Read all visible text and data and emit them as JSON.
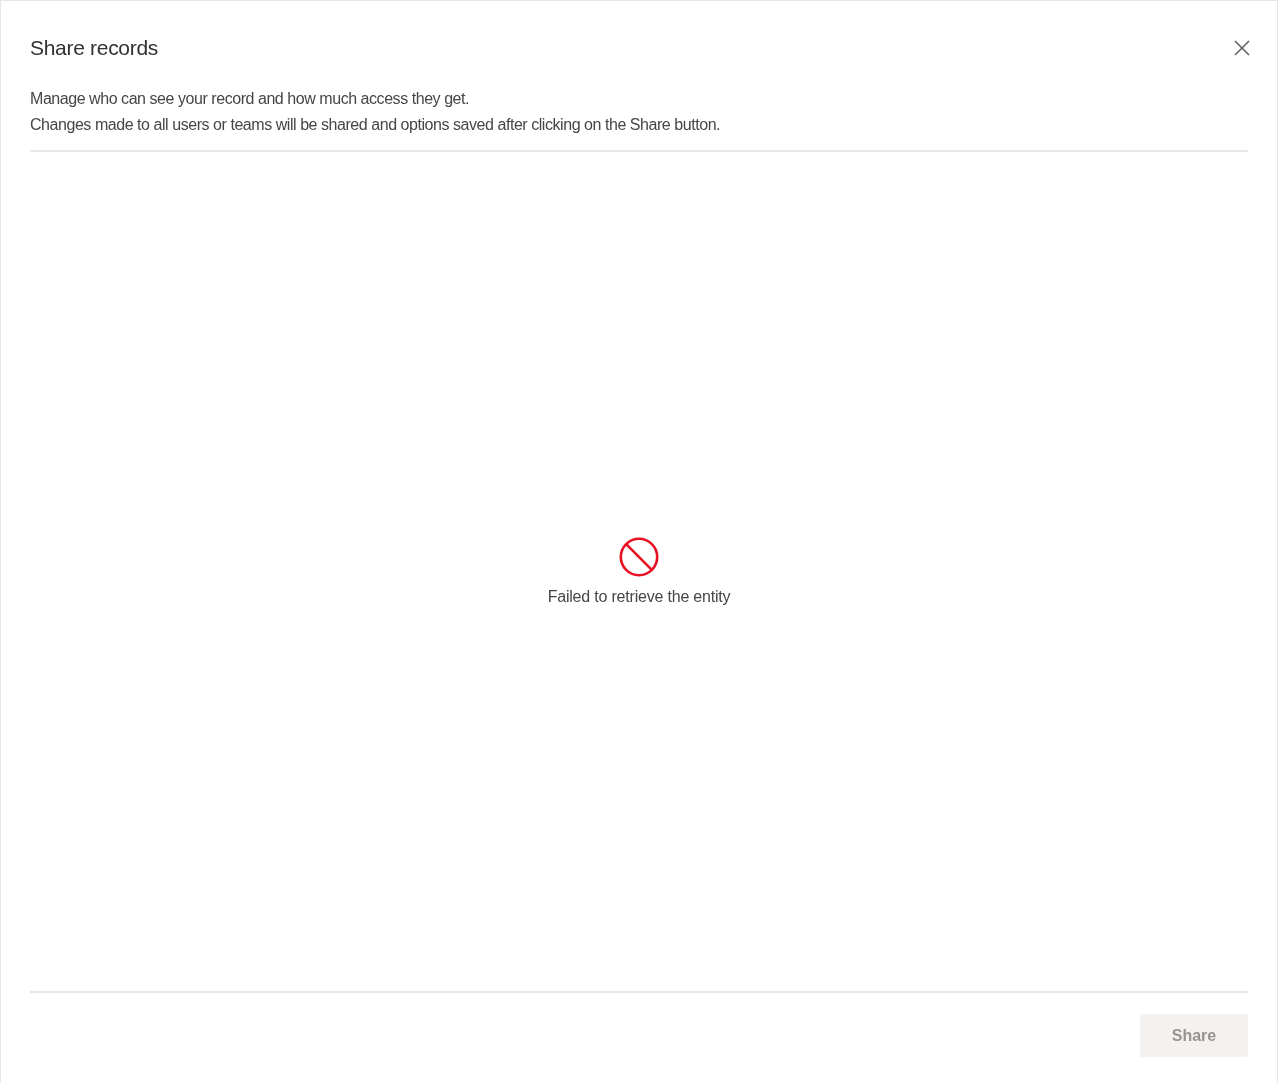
{
  "dialog": {
    "title": "Share records",
    "description": [
      "Manage who can see your record and how much access they get.",
      "Changes made to all users or teams will be shared and options saved after clicking on the Share button."
    ]
  },
  "error": {
    "message": "Failed to retrieve the entity"
  },
  "buttons": [
    {
      "label": "Share",
      "disabled": true
    }
  ]
}
